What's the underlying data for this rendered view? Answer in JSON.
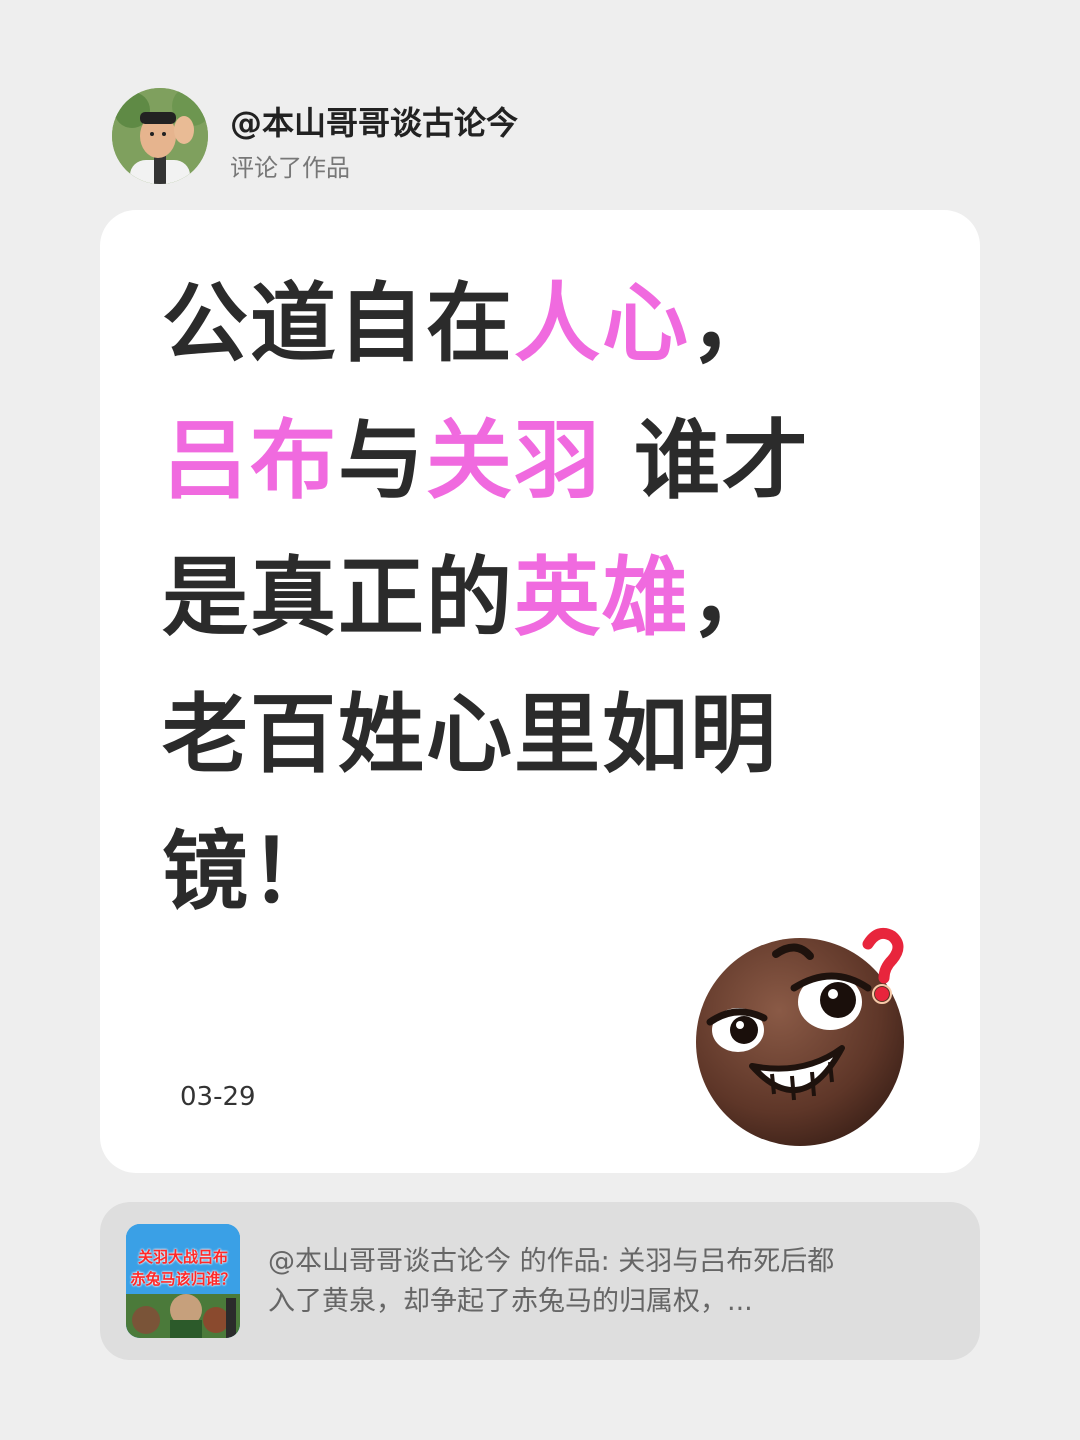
{
  "header": {
    "username": "@本山哥哥谈古论今",
    "action": "评论了作品"
  },
  "comment": {
    "line1_a": "公道自在",
    "line1_hl": "人心",
    "line1_b": "，",
    "line2_hl1": "吕布",
    "line2_a": "与",
    "line2_hl2": "关羽",
    "line2_b": " 谁才",
    "line3_a": "是真正的",
    "line3_hl": "英雄",
    "line3_b": "，",
    "line4": "老百姓心里如明",
    "line5": "镜！",
    "date": "03-29",
    "highlight_color": "#f06adf",
    "emoji": "thinking-grin-emoji"
  },
  "reference": {
    "thumb_title_1": "关羽大战吕布",
    "thumb_title_2": "赤兔马该归谁？",
    "text_line1": "@本山哥哥谈古论今 的作品: 关羽与吕布死后都",
    "text_line2": "入了黄泉，却争起了赤兔马的归属权，..."
  }
}
